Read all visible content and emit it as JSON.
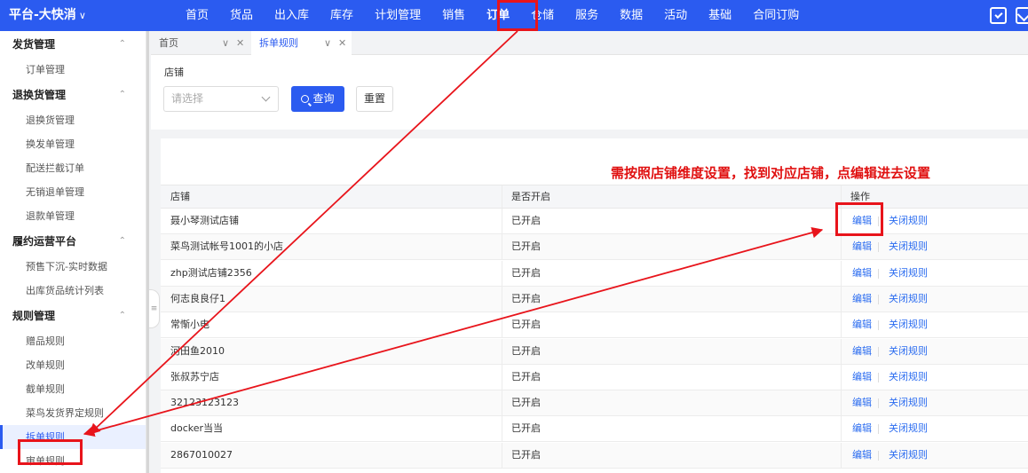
{
  "brand": {
    "title": "平台-大快消",
    "chevron": "∨"
  },
  "nav": {
    "items": [
      "首页",
      "货品",
      "出入库",
      "库存",
      "计划管理",
      "销售",
      "订单",
      "仓储",
      "服务",
      "数据",
      "活动",
      "基础",
      "合同订购"
    ],
    "active": "订单"
  },
  "sidebar": {
    "groups": [
      {
        "title": "发货管理",
        "items": [
          "订单管理"
        ]
      },
      {
        "title": "退换货管理",
        "items": [
          "退换货管理",
          "换发单管理",
          "配送拦截订单",
          "无销退单管理",
          "退款单管理"
        ]
      },
      {
        "title": "履约运营平台",
        "items": [
          "预售下沉-实时数据",
          "出库货品统计列表"
        ]
      },
      {
        "title": "规则管理",
        "items": [
          "赠品规则",
          "改单规则",
          "截单规则",
          "菜鸟发货界定规则",
          "拆单规则",
          "审单规则"
        ]
      }
    ],
    "active_item": "拆单规则"
  },
  "tabs": [
    {
      "label": "首页",
      "active": false
    },
    {
      "label": "拆单规则",
      "active": true
    }
  ],
  "filter": {
    "shop_label": "店铺",
    "shop_placeholder": "请选择",
    "query_label": "查询",
    "reset_label": "重置"
  },
  "annotation": "需按照店铺维度设置，找到对应店铺，点编辑进去设置",
  "table": {
    "columns": [
      "店铺",
      "是否开启",
      "操作"
    ],
    "rows": [
      {
        "shop": "聂小琴测试店铺",
        "status": "已开启",
        "edit": "编辑",
        "close": "关闭规则"
      },
      {
        "shop": "菜鸟测试帐号1001的小店",
        "status": "已开启",
        "edit": "编辑",
        "close": "关闭规则"
      },
      {
        "shop": "zhp测试店铺2356",
        "status": "已开启",
        "edit": "编辑",
        "close": "关闭规则"
      },
      {
        "shop": "何志良良仔1",
        "status": "已开启",
        "edit": "编辑",
        "close": "关闭规则"
      },
      {
        "shop": "常惭小电",
        "status": "已开启",
        "edit": "编辑",
        "close": "关闭规则"
      },
      {
        "shop": "河田鱼2010",
        "status": "已开启",
        "edit": "编辑",
        "close": "关闭规则"
      },
      {
        "shop": "张叔苏宁店",
        "status": "已开启",
        "edit": "编辑",
        "close": "关闭规则"
      },
      {
        "shop": "32123123123",
        "status": "已开启",
        "edit": "编辑",
        "close": "关闭规则"
      },
      {
        "shop": "docker当当",
        "status": "已开启",
        "edit": "编辑",
        "close": "关闭规则"
      },
      {
        "shop": "2867010027",
        "status": "已开启",
        "edit": "编辑",
        "close": "关闭规则"
      }
    ]
  },
  "colors": {
    "primary": "#2b5bf0",
    "annotation": "#e8141b",
    "link": "#2b6cf0"
  },
  "icons": [
    "calendar-check-icon",
    "mail-icon",
    "search-icon",
    "chevron-down-icon",
    "close-icon",
    "caret-up-icon"
  ]
}
